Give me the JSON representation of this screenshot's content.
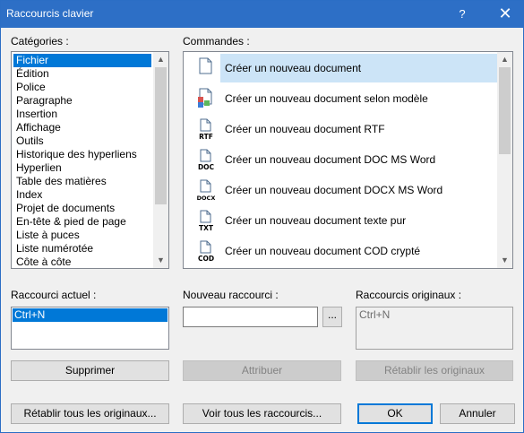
{
  "window": {
    "title": "Raccourcis clavier",
    "help_glyph": "?",
    "close_glyph": "✕"
  },
  "categories": {
    "label": "Catégories :",
    "items": [
      "Fichier",
      "Édition",
      "Police",
      "Paragraphe",
      "Insertion",
      "Affichage",
      "Outils",
      "Historique des hyperliens",
      "Hyperlien",
      "Table des matières",
      "Index",
      "Projet de documents",
      "En-tête & pied de page",
      "Liste à puces",
      "Liste numérotée",
      "Côte à côte"
    ],
    "selected": "Fichier"
  },
  "commands": {
    "label": "Commandes :",
    "items": [
      {
        "text": "Créer un nouveau document",
        "icon": "new-document-icon",
        "badge": ""
      },
      {
        "text": "Créer un nouveau document selon modèle",
        "icon": "template-document-icon",
        "badge": ""
      },
      {
        "text": "Créer un nouveau document RTF",
        "icon": "rtf-document-icon",
        "badge": "RTF"
      },
      {
        "text": "Créer un nouveau document DOC MS Word",
        "icon": "doc-document-icon",
        "badge": "DOC"
      },
      {
        "text": "Créer un nouveau document DOCX MS Word",
        "icon": "docx-document-icon",
        "badge": "DOCX"
      },
      {
        "text": "Créer un nouveau document texte pur",
        "icon": "txt-document-icon",
        "badge": "TXT"
      },
      {
        "text": "Créer un nouveau document COD crypté",
        "icon": "cod-document-icon",
        "badge": "COD"
      }
    ],
    "selected": "Créer un nouveau document"
  },
  "current_shortcut": {
    "label": "Raccourci actuel :",
    "value": "Ctrl+N"
  },
  "new_shortcut": {
    "label": "Nouveau raccourci :",
    "value": "",
    "browse_label": "..."
  },
  "original_shortcuts": {
    "label": "Raccourcis originaux :",
    "value": "Ctrl+N"
  },
  "buttons": {
    "delete": "Supprimer",
    "assign": "Attribuer",
    "restore_originals": "Rétablir les originaux",
    "restore_all": "Rétablir tous les originaux...",
    "view_all": "Voir tous les raccourcis...",
    "ok": "OK",
    "cancel": "Annuler"
  }
}
